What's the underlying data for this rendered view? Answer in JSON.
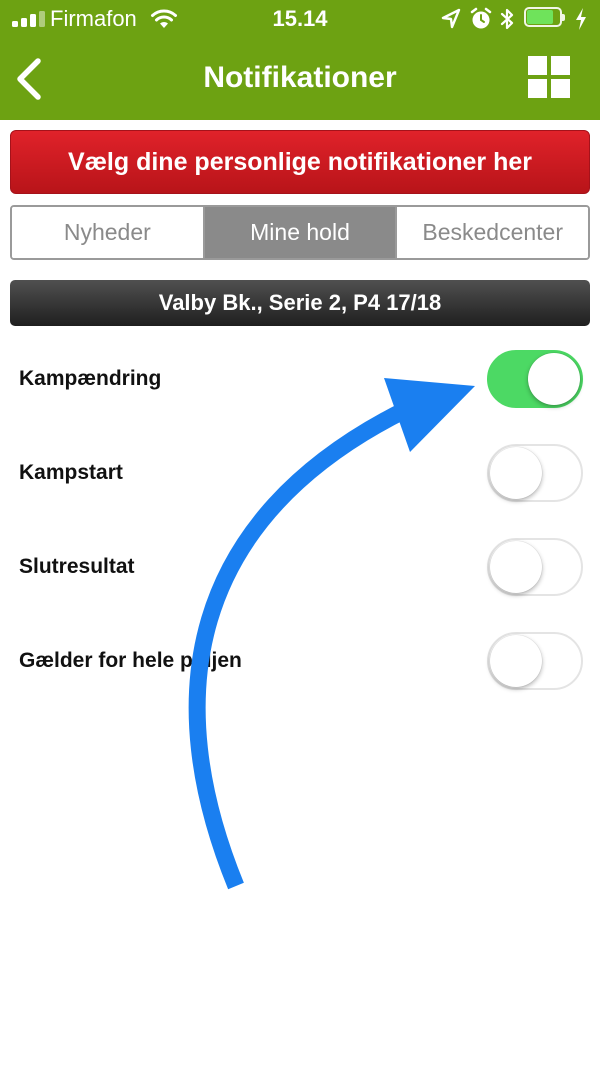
{
  "status_bar": {
    "carrier": "Firmafon",
    "time": "15.14",
    "signal_bars": 4,
    "signal_bars_filled": 3,
    "battery_level": 0.8,
    "icons": [
      "signal-icon",
      "wifi-icon",
      "location-icon",
      "alarm-icon",
      "bluetooth-icon",
      "battery-icon",
      "charging-icon"
    ]
  },
  "nav": {
    "title": "Notifikationer",
    "back_icon": "chevron-left-icon",
    "menu_icon": "grid-icon",
    "background": "#6da212"
  },
  "banner": {
    "text": "Vælg dine personlige notifikationer her",
    "color": "#d01c22"
  },
  "tabs": [
    {
      "label": "Nyheder",
      "active": false
    },
    {
      "label": "Mine hold",
      "active": true
    },
    {
      "label": "Beskedcenter",
      "active": false
    }
  ],
  "team_header": "Valby Bk., Serie 2, P4 17/18",
  "settings": [
    {
      "label": "Kampændring",
      "enabled": true
    },
    {
      "label": "Kampstart",
      "enabled": false
    },
    {
      "label": "Slutresultat",
      "enabled": false
    },
    {
      "label": "Gælder for hele puljen",
      "enabled": false
    }
  ],
  "colors": {
    "toggle_on": "#4cd964",
    "annotation_arrow": "#1a7ff0"
  },
  "annotation": {
    "icon": "curved-arrow-icon"
  }
}
